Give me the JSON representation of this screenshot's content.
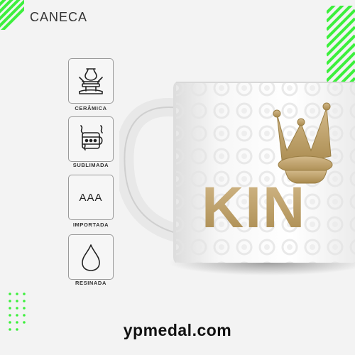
{
  "header": {
    "title": "CANECA"
  },
  "features": [
    {
      "label": "CERÂMICA",
      "icon": "pottery-wheel-icon"
    },
    {
      "label": "SUBLIMADA",
      "icon": "heat-sublimation-icon"
    },
    {
      "label": "IMPORTADA",
      "icon": "aaa-quality-icon",
      "icon_text": "AAA"
    },
    {
      "label": "RESINADA",
      "icon": "resin-drop-icon"
    }
  ],
  "product": {
    "print_text": "KIN",
    "image": "white-mug-king-crown-print"
  },
  "footer": {
    "website": "ypmedal.com"
  },
  "colors": {
    "accent_green": "#3cf03c",
    "gold": "#b89a5c",
    "text_dark": "#222222"
  }
}
